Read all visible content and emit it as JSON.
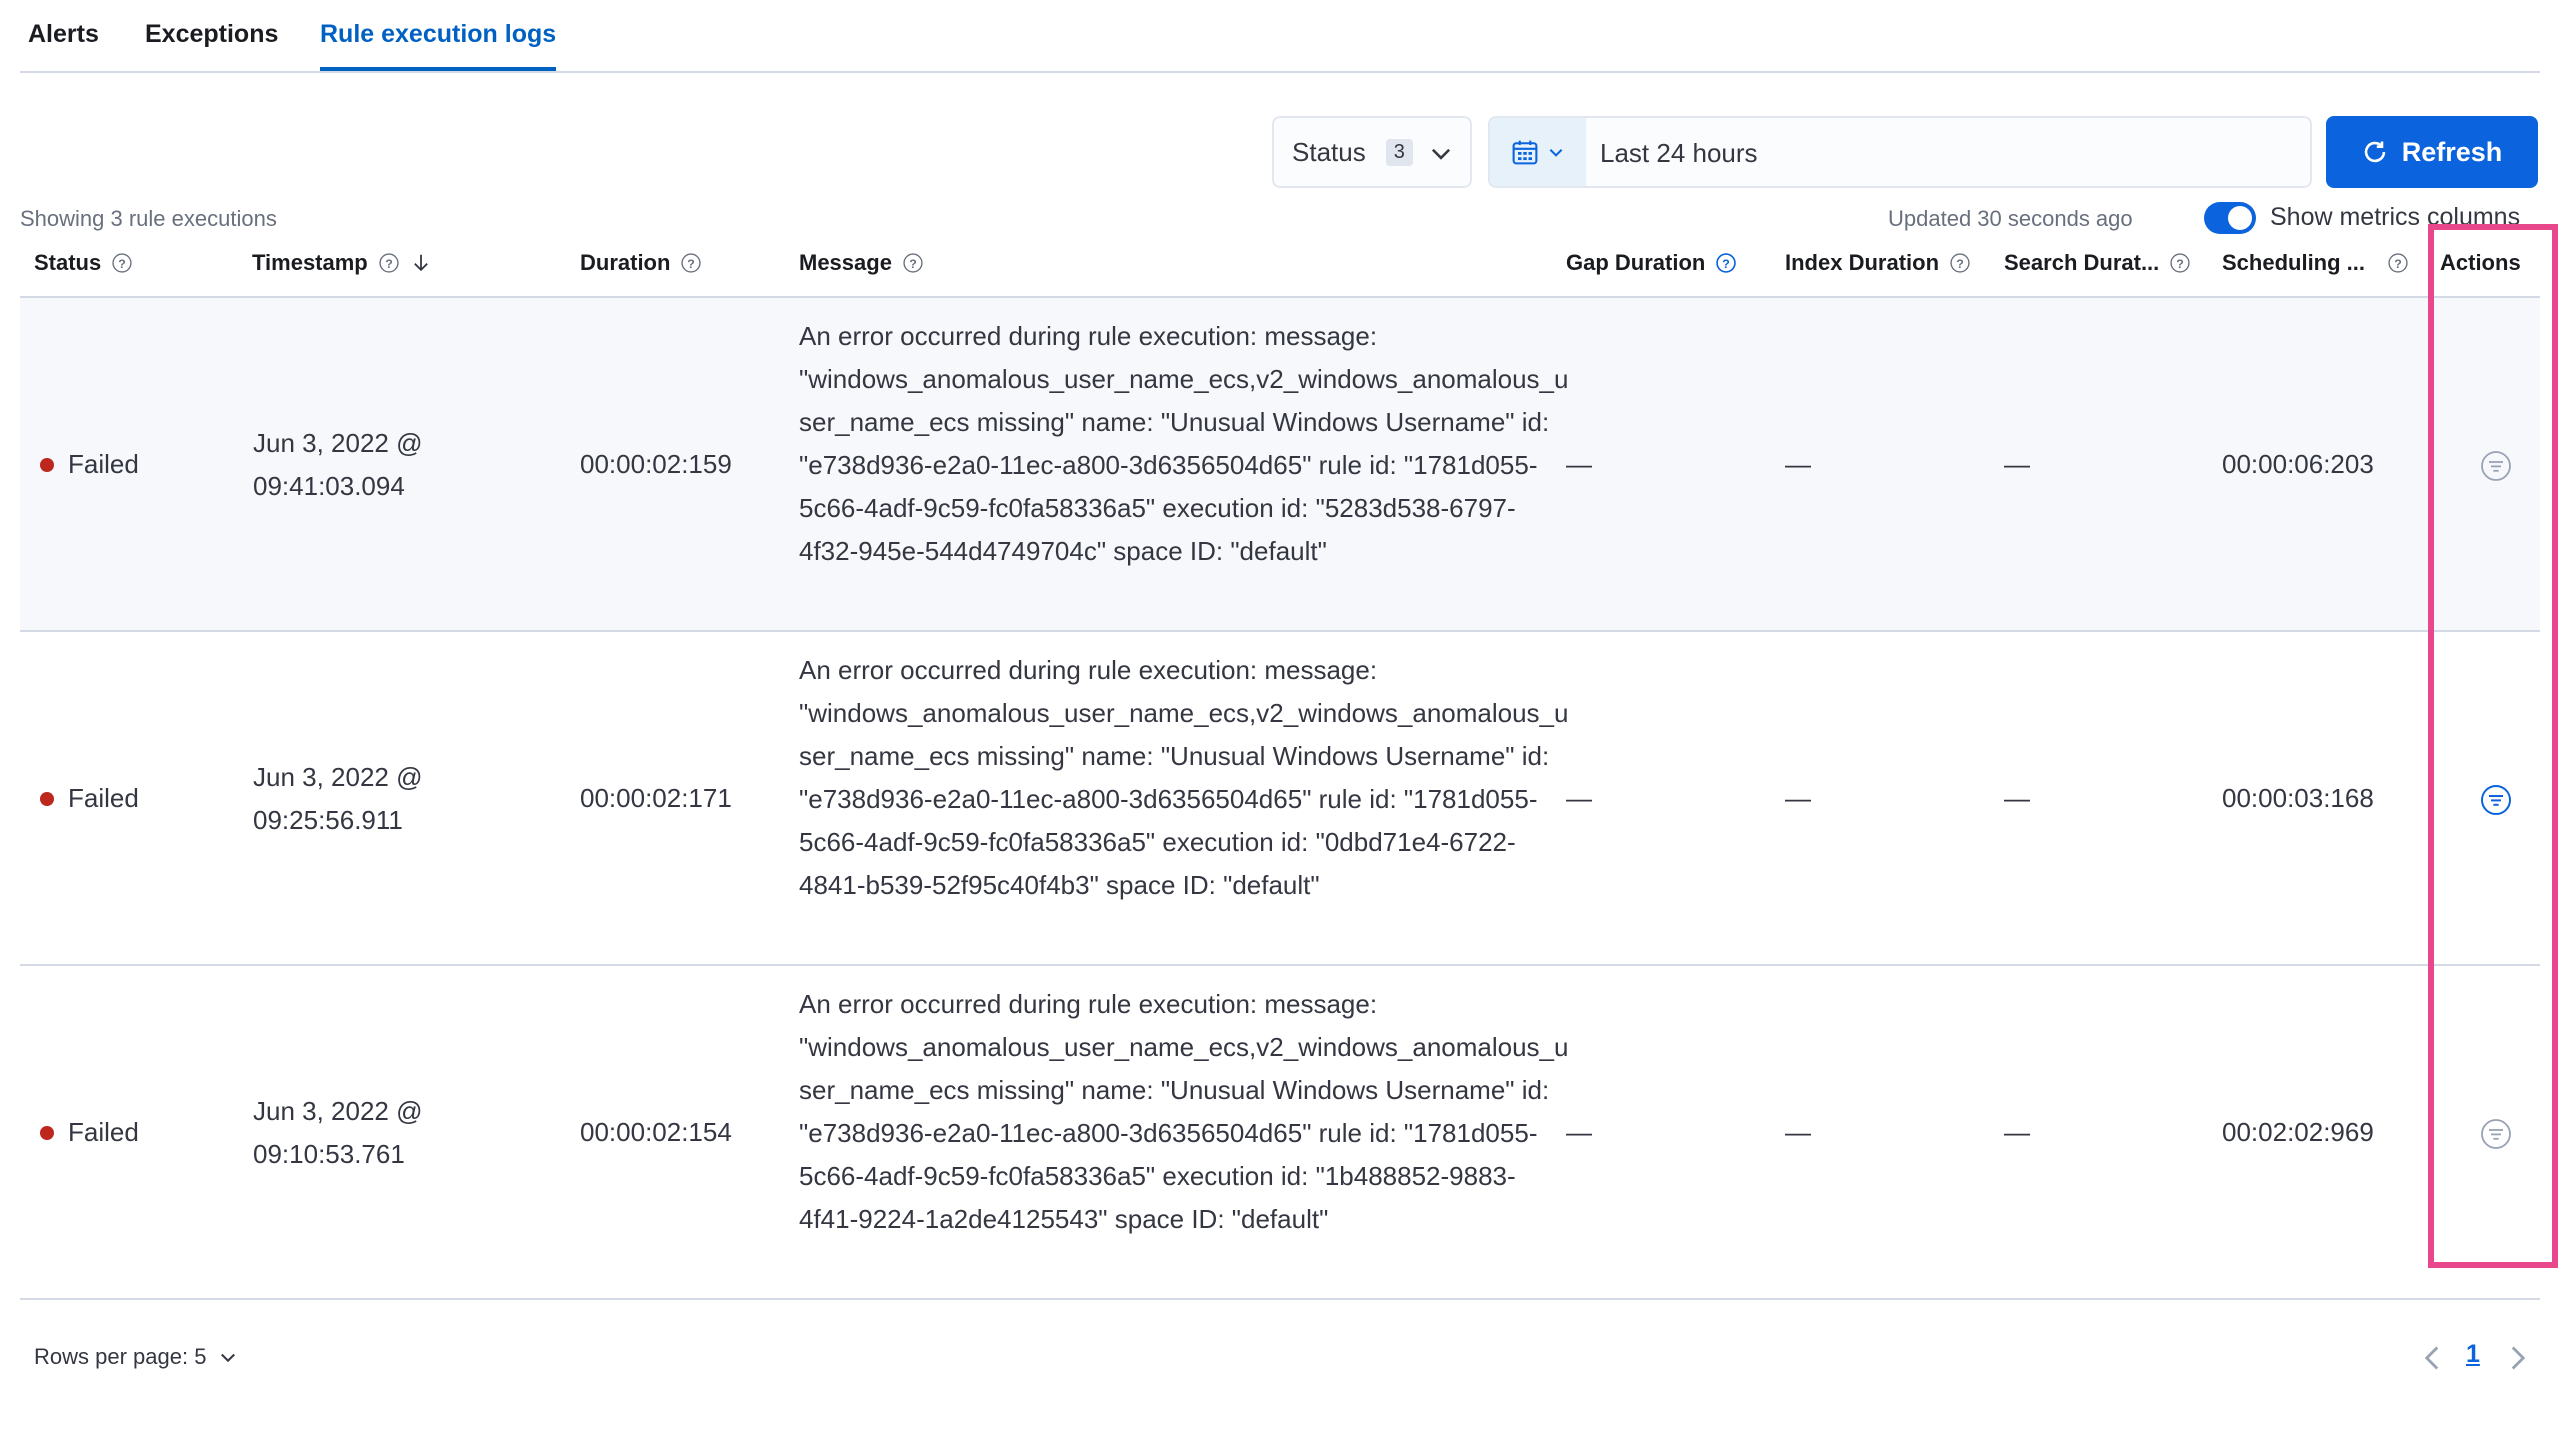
{
  "tabs": [
    {
      "label": "Alerts",
      "active": false
    },
    {
      "label": "Exceptions",
      "active": false
    },
    {
      "label": "Rule execution logs",
      "active": true
    }
  ],
  "toolbar": {
    "status_filter_label": "Status",
    "status_filter_count": "3",
    "date_range": "Last 24 hours",
    "refresh_label": "Refresh"
  },
  "meta": {
    "showing": "Showing 3 rule executions",
    "updated": "Updated 30 seconds ago",
    "metrics_toggle_label": "Show metrics columns",
    "metrics_toggle_on": true
  },
  "table": {
    "columns": [
      "Status",
      "Timestamp",
      "Duration",
      "Message",
      "Gap Duration",
      "Index Duration",
      "Search Durat...",
      "Scheduling ...",
      "Actions"
    ],
    "rows": [
      {
        "status": "Failed",
        "timestamp_line1": "Jun 3, 2022 @",
        "timestamp_line2": "09:41:03.094",
        "duration": "00:00:02:159",
        "message": "An error occurred during rule execution: message: \"windows_anomalous_user_name_ecs,v2_windows_anomalous_user_name_ecs missing\" name: \"Unusual Windows Username\" id: \"e738d936-e2a0-11ec-a800-3d6356504d65\" rule id: \"1781d055-5c66-4adf-9c59-fc0fa58336a5\" execution id: \"5283d538-6797-4f32-945e-544d4749704c\" space ID: \"default\"",
        "gap_duration": "—",
        "index_duration": "—",
        "search_duration": "—",
        "scheduling": "00:00:06:203"
      },
      {
        "status": "Failed",
        "timestamp_line1": "Jun 3, 2022 @",
        "timestamp_line2": "09:25:56.911",
        "duration": "00:00:02:171",
        "message": "An error occurred during rule execution: message: \"windows_anomalous_user_name_ecs,v2_windows_anomalous_user_name_ecs missing\" name: \"Unusual Windows Username\" id: \"e738d936-e2a0-11ec-a800-3d6356504d65\" rule id: \"1781d055-5c66-4adf-9c59-fc0fa58336a5\" execution id: \"0dbd71e4-6722-4841-b539-52f95c40f4b3\" space ID: \"default\"",
        "gap_duration": "—",
        "index_duration": "—",
        "search_duration": "—",
        "scheduling": "00:00:03:168"
      },
      {
        "status": "Failed",
        "timestamp_line1": "Jun 3, 2022 @",
        "timestamp_line2": "09:10:53.761",
        "duration": "00:00:02:154",
        "message": "An error occurred during rule execution: message: \"windows_anomalous_user_name_ecs,v2_windows_anomalous_user_name_ecs missing\" name: \"Unusual Windows Username\" id: \"e738d936-e2a0-11ec-a800-3d6356504d65\" rule id: \"1781d055-5c66-4adf-9c59-fc0fa58336a5\" execution id: \"1b488852-9883-4f41-9224-1a2de4125543\" space ID: \"default\"",
        "gap_duration": "—",
        "index_duration": "—",
        "search_duration": "—",
        "scheduling": "00:02:02:969"
      }
    ]
  },
  "pagination": {
    "rows_per_page": "Rows per page: 5",
    "current_page": "1"
  },
  "icons": {
    "help": "question-circle-icon",
    "sort": "arrow-down-icon",
    "action": "filter-in-circle-icon",
    "calendar": "calendar-icon",
    "refresh": "refresh-icon"
  },
  "colors": {
    "accent": "#0b64dd",
    "failed": "#bd271e",
    "highlight": "#e8488b"
  }
}
